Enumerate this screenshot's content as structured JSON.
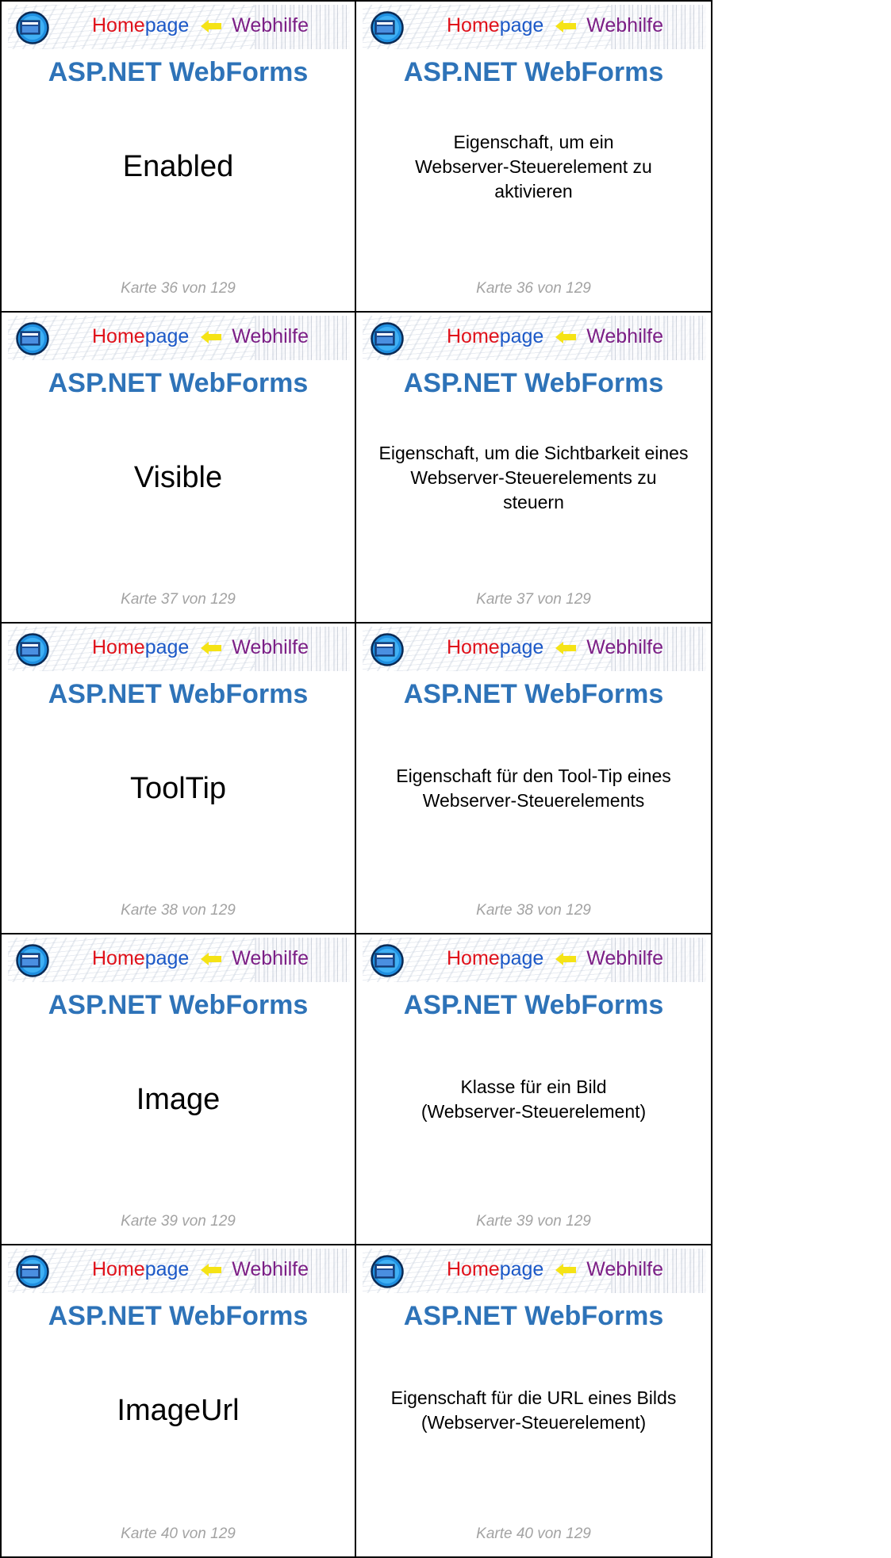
{
  "banner": {
    "home": "Home",
    "page": "page",
    "web": "Webhilfe"
  },
  "colors": {
    "heading": "#2e73b8",
    "home": "#e0121b",
    "page": "#1b58c7",
    "webhilfe": "#7c1f86",
    "footer": "#a3a3a3"
  },
  "cards": [
    {
      "heading": "ASP.NET WebForms",
      "term": "Enabled",
      "definition_lines": [
        "Eigenschaft, um ein",
        "Webserver-Steuerelement zu",
        "aktivieren"
      ],
      "footer": "Karte 36 von 129"
    },
    {
      "heading": "ASP.NET WebForms",
      "term": "Visible",
      "definition_lines": [
        "Eigenschaft, um die Sichtbarkeit eines",
        "Webserver-Steuerelements zu",
        "steuern"
      ],
      "footer": "Karte 37 von 129"
    },
    {
      "heading": "ASP.NET WebForms",
      "term": "ToolTip",
      "definition_lines": [
        "Eigenschaft für den Tool-Tip eines",
        "Webserver-Steuerelements"
      ],
      "footer": "Karte 38 von 129"
    },
    {
      "heading": "ASP.NET WebForms",
      "term": "Image",
      "definition_lines": [
        "Klasse für ein Bild",
        "(Webserver-Steuerelement)"
      ],
      "footer": "Karte 39 von 129"
    },
    {
      "heading": "ASP.NET WebForms",
      "term": "ImageUrl",
      "definition_lines": [
        "Eigenschaft für die URL eines Bilds",
        "(Webserver-Steuerelement)"
      ],
      "footer": "Karte 40 von 129"
    }
  ]
}
